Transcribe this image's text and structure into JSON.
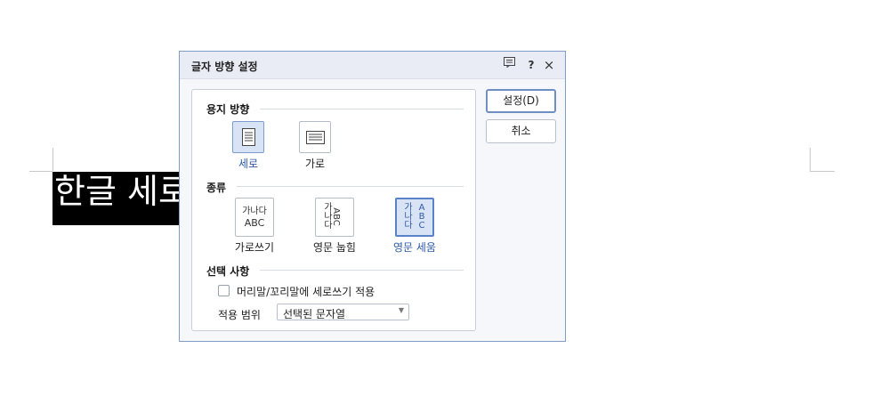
{
  "document": {
    "text": "한글 세로"
  },
  "dialog": {
    "title": "글자 방향 설정",
    "icons": {
      "comment": "comment-icon",
      "help": "?",
      "close": "×"
    },
    "sections": {
      "paper_direction": {
        "title": "용지 방향",
        "options": [
          {
            "label": "세로",
            "selected": true,
            "icon": "portrait-page-icon"
          },
          {
            "label": "가로",
            "selected": false,
            "icon": "landscape-page-icon"
          }
        ]
      },
      "type": {
        "title": "종류",
        "options": [
          {
            "label": "가로쓰기",
            "selected": false,
            "line1": "가나다",
            "line2": "ABC"
          },
          {
            "label": "영문 눕힘",
            "selected": false,
            "vertical": "가나다",
            "rotated": "ABC"
          },
          {
            "label": "영문 세움",
            "selected": true,
            "vertical": "가나다",
            "vertical2": "ABC"
          }
        ]
      },
      "options": {
        "title": "선택 사항",
        "checkbox_label": "머리말/꼬리말에 세로쓰기 적용",
        "checkbox_checked": false,
        "range_label": "적용 범위",
        "range_value": "선택된 문자열"
      }
    },
    "buttons": {
      "ok": "설정(D)",
      "cancel": "취소"
    }
  }
}
